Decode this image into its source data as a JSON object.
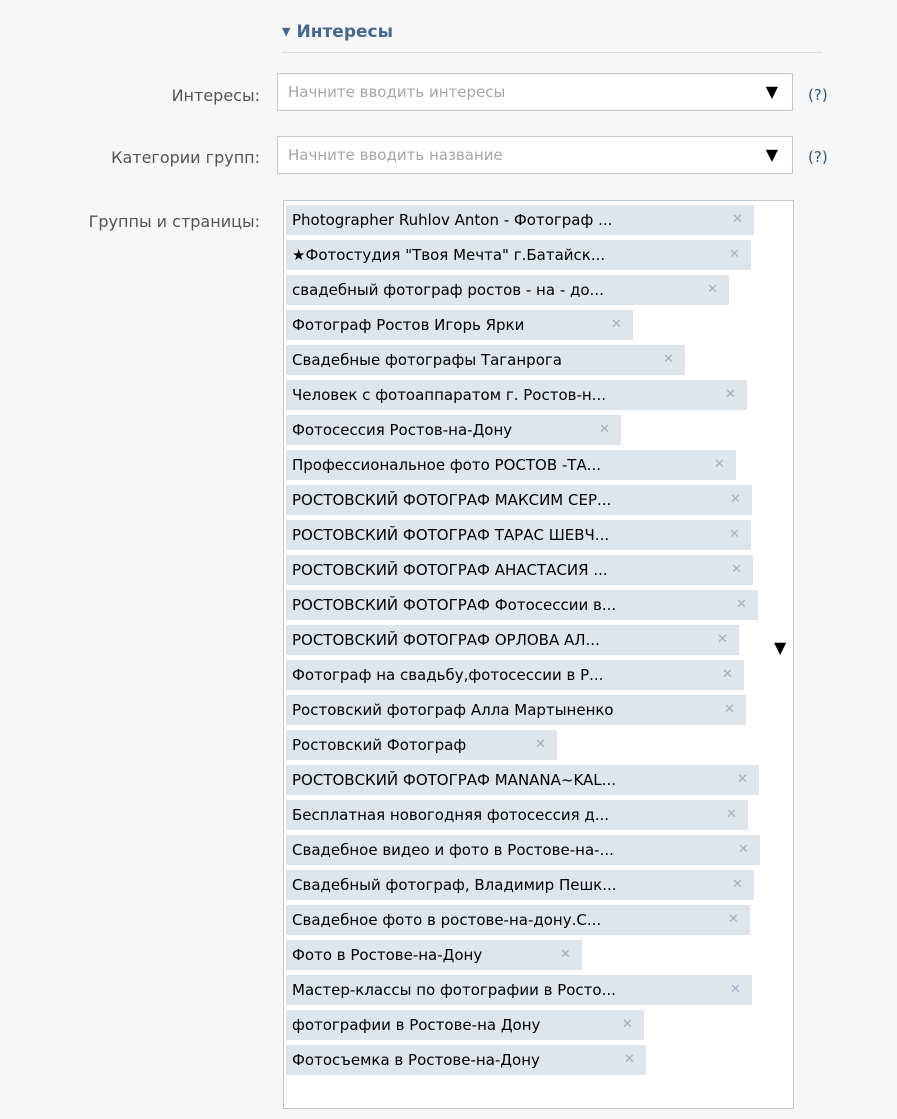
{
  "section": {
    "arrow": "▼",
    "title": "Интересы"
  },
  "interests": {
    "label": "Интересы:",
    "placeholder": "Начните вводить интересы",
    "dropdown_icon": "▼",
    "help": "(?)"
  },
  "categories": {
    "label": "Категории групп:",
    "placeholder": "Начните вводить название",
    "dropdown_icon": "▼",
    "help": "(?)"
  },
  "groups": {
    "label": "Группы и страницы:",
    "dropdown_icon": "▼",
    "remove_icon": "✕",
    "tokens": [
      "Photographer Ruhlov Anton - Фотограф ...",
      "★Фотостудия \"Твоя Мечта\" г.Батайск...",
      "свадебный фотограф ростов - на - до...",
      "Фотограф Ростов Игорь Ярки",
      "Свадебные фотографы Таганрога",
      "Человек с фотоаппаратом г. Ростов-н...",
      "Фотосессия Ростов-на-Дону",
      "Профессиональное фото РОСТОВ -ТА...",
      "РОСТОВСКИЙ ФОТОГРАФ МАКСИМ СЕР...",
      "РОСТОВСКИЙ ФОТОГРАФ ТАРАС ШЕВЧ...",
      "РОСТОВСКИЙ ФОТОГРАФ АНАСТАСИЯ ...",
      "РОСТОВСКИЙ ФОТОГРАФ Фотосессии в...",
      "РОСТОВСКИЙ ФОТОГРАФ ОРЛОВА АЛ...",
      "Фотограф на свадьбу,фотосессии в Р...",
      "Ростовский фотограф Алла Мартыненко",
      "Ростовский Фотограф",
      "РОСТОВСКИЙ ФОТОГРАФ MANANA~KAL...",
      "Бесплатная новогодняя фотосессия д...",
      "Свадебное видео и фото в Ростове-на-...",
      "Свадебный фотограф, Владимир Пешк...",
      "Свадебное фото в ростове-на-дону.С...",
      "Фото в Ростове-на-Дону",
      "Мастер-классы по фотографии в Росто...",
      "фотографии в Ростове-на Дону",
      "Фотосъемка в Ростове-на-Дону"
    ]
  }
}
